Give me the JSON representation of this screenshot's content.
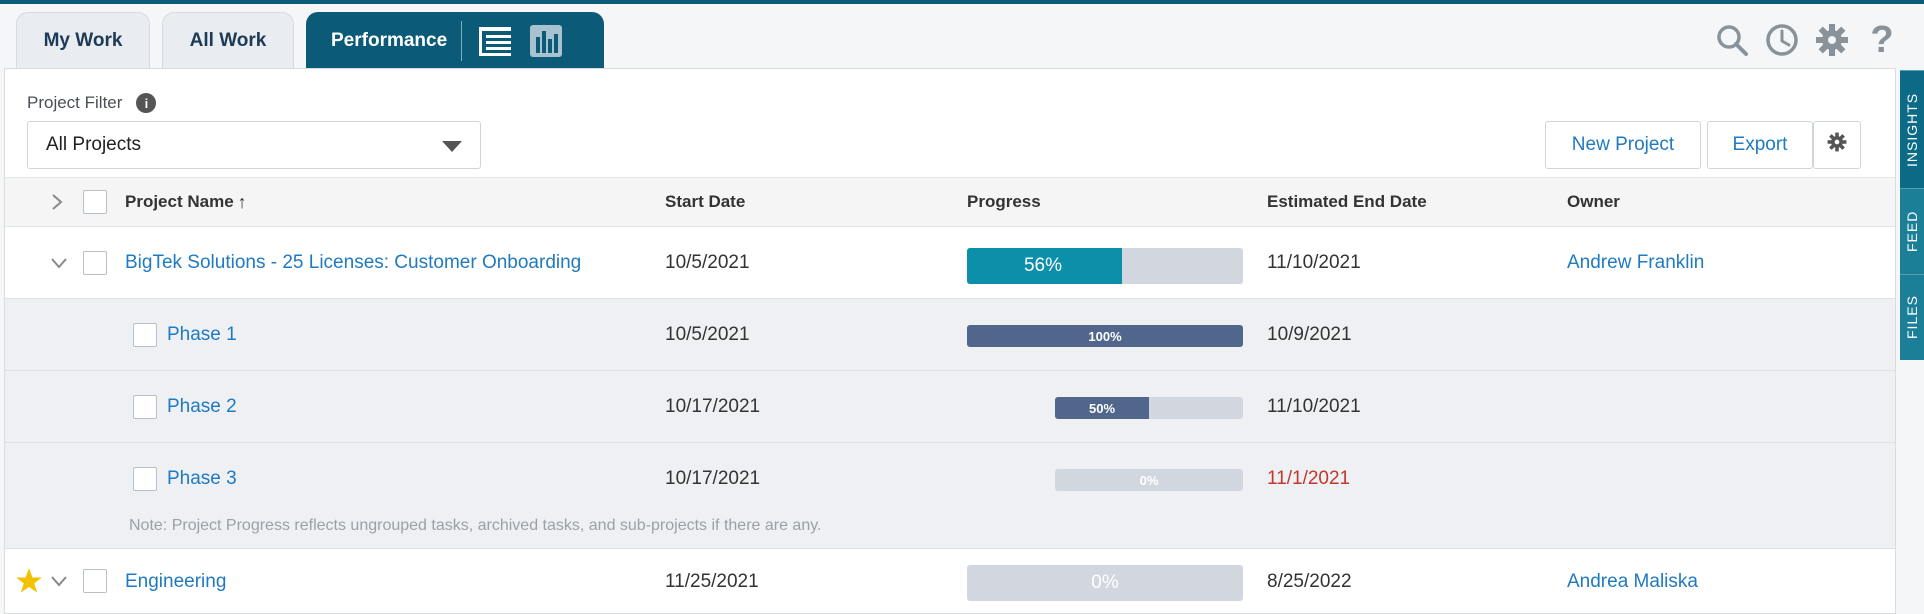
{
  "tabs": [
    {
      "label": "My Work"
    },
    {
      "label": "All Work"
    },
    {
      "label": "Performance"
    }
  ],
  "toolbar_icons": [
    "search-icon",
    "clock-icon",
    "gear-icon",
    "help-icon"
  ],
  "filter": {
    "label": "Project Filter",
    "value": "All Projects"
  },
  "actions": {
    "new_project": "New Project",
    "export": "Export"
  },
  "columns": {
    "project_name": "Project Name",
    "start_date": "Start Date",
    "progress": "Progress",
    "end_date": "Estimated End Date",
    "owner": "Owner"
  },
  "rows": [
    {
      "name": "BigTek Solutions - 25 Licenses: Customer Onboarding",
      "start": "10/5/2021",
      "progress": 0.56,
      "progress_label": "56%",
      "end": "11/10/2021",
      "owner": "Andrew Franklin"
    },
    {
      "name": "Phase 1",
      "start": "10/5/2021",
      "progress": 1.0,
      "progress_label": "100%",
      "end": "10/9/2021",
      "owner": ""
    },
    {
      "name": "Phase 2",
      "start": "10/17/2021",
      "progress": 0.5,
      "progress_label": "50%",
      "end": "11/10/2021",
      "owner": ""
    },
    {
      "name": "Phase 3",
      "start": "10/17/2021",
      "progress": 0.0,
      "progress_label": "0%",
      "end": "11/1/2021",
      "owner": ""
    },
    {
      "name": "Engineering",
      "start": "11/25/2021",
      "progress": 0.0,
      "progress_label": "0%",
      "end": "8/25/2022",
      "owner": "Andrea Maliska"
    }
  ],
  "note": "Note: Project Progress reflects ungrouped tasks, archived tasks, and sub-projects if there are any.",
  "side_tabs": [
    "INSIGHTS",
    "FEED",
    "FILES"
  ],
  "colors": {
    "brand": "#0b5a78",
    "progress_primary": "#0c8fa8",
    "progress_phase": "#50668a",
    "link": "#1f7ac0",
    "late": "#c0392b",
    "star": "#f2c200"
  }
}
